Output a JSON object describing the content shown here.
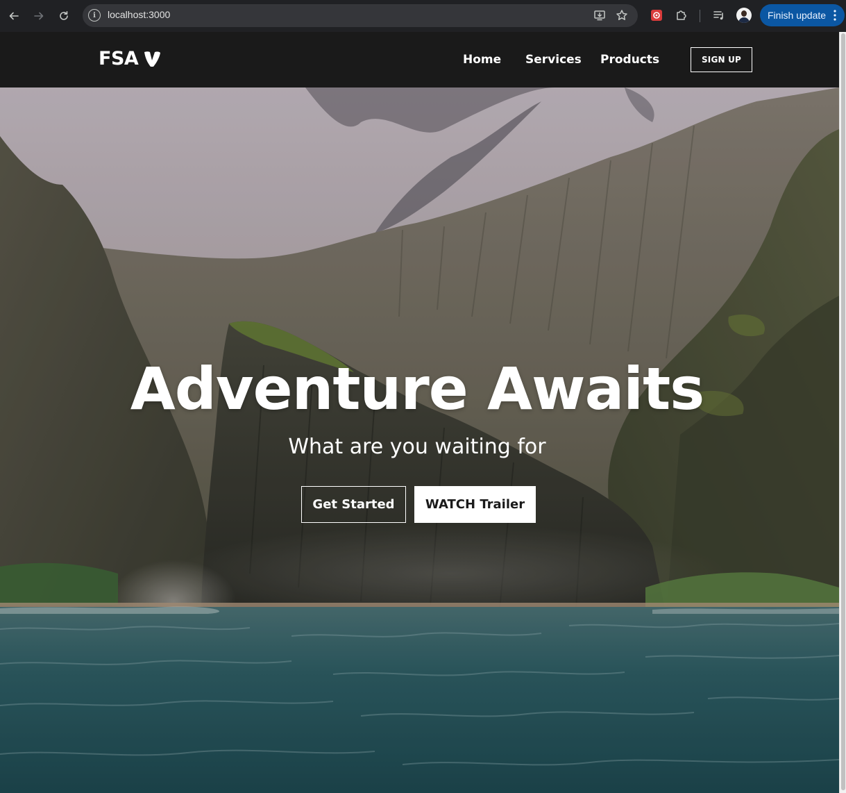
{
  "browser": {
    "url": "localhost:3000",
    "finish_update_label": "Finish update"
  },
  "site": {
    "logo_text": "FSA",
    "nav": [
      "Home",
      "Services",
      "Products"
    ],
    "signup_label": "SIGN UP"
  },
  "hero": {
    "title": "Adventure Awaits",
    "subtitle": "What are you waiting for",
    "primary_button": "Get Started",
    "secondary_button": "WATCH Trailer"
  },
  "colors": {
    "chrome_bg": "#202124",
    "omnibox_bg": "#35363a",
    "update_button": "#0b57a3",
    "site_nav_bg": "#1a1a1a",
    "hero_text": "#ffffff",
    "sea": "#2e5f66"
  },
  "icons": [
    "back-arrow-icon",
    "forward-arrow-icon",
    "reload-icon",
    "site-info-icon",
    "install-app-icon",
    "bookmark-star-icon",
    "extension-puzzle-icon",
    "media-control-icon",
    "more-vert-icon",
    "brand-v-icon"
  ]
}
